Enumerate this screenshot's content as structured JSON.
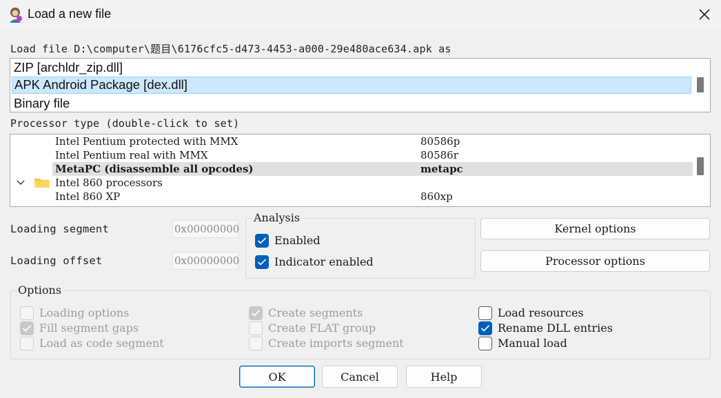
{
  "window": {
    "title": "Load a new file",
    "close_icon": "close-icon",
    "app_icon": "ida-app-icon"
  },
  "load_file": {
    "label": "Load file D:\\computer\\题目\\6176cfc5-d473-4453-a000-29e480ace634.apk as",
    "options": [
      "ZIP [archldr_zip.dll]",
      "APK Android Package [dex.dll]",
      "Binary file"
    ],
    "selected": "APK Android Package [dex.dll]"
  },
  "processor": {
    "label": "Processor type (double-click to set)",
    "rows": [
      {
        "name": "Intel Pentium protected with MMX",
        "code": "80586p"
      },
      {
        "name": "Intel Pentium real with MMX",
        "code": "80586r"
      },
      {
        "name": "MetaPC (disassemble all opcodes)",
        "code": "metapc",
        "selected": true
      },
      {
        "name": "Intel 860 processors",
        "code": "",
        "group": true
      },
      {
        "name": "Intel 860 XP",
        "code": "860xp"
      }
    ]
  },
  "loading": {
    "segment_label": "Loading segment",
    "segment_value": "0x00000000",
    "offset_label": "Loading offset",
    "offset_value": "0x00000000"
  },
  "analysis": {
    "title": "Analysis",
    "enabled_label": "Enabled",
    "enabled": true,
    "indicator_label": "Indicator enabled",
    "indicator": true
  },
  "side_buttons": {
    "kernel": "Kernel options",
    "processor": "Processor options"
  },
  "options": {
    "title": "Options",
    "col1": [
      {
        "label": "Loading options",
        "checked": false,
        "disabled": true
      },
      {
        "label": "Fill segment gaps",
        "checked": true,
        "disabled": true
      },
      {
        "label": "Load as code segment",
        "checked": false,
        "disabled": true
      }
    ],
    "col2": [
      {
        "label": "Create segments",
        "checked": true,
        "disabled": true
      },
      {
        "label": "Create FLAT group",
        "checked": false,
        "disabled": true
      },
      {
        "label": "Create imports segment",
        "checked": false,
        "disabled": true
      }
    ],
    "col3": [
      {
        "label": "Load resources",
        "checked": false,
        "disabled": false
      },
      {
        "label": "Rename DLL entries",
        "checked": true,
        "disabled": false
      },
      {
        "label": "Manual load",
        "checked": false,
        "disabled": false
      }
    ]
  },
  "footer": {
    "ok": "OK",
    "cancel": "Cancel",
    "help": "Help"
  },
  "colors": {
    "accent": "#005fb8",
    "selection": "#cce8ff"
  }
}
